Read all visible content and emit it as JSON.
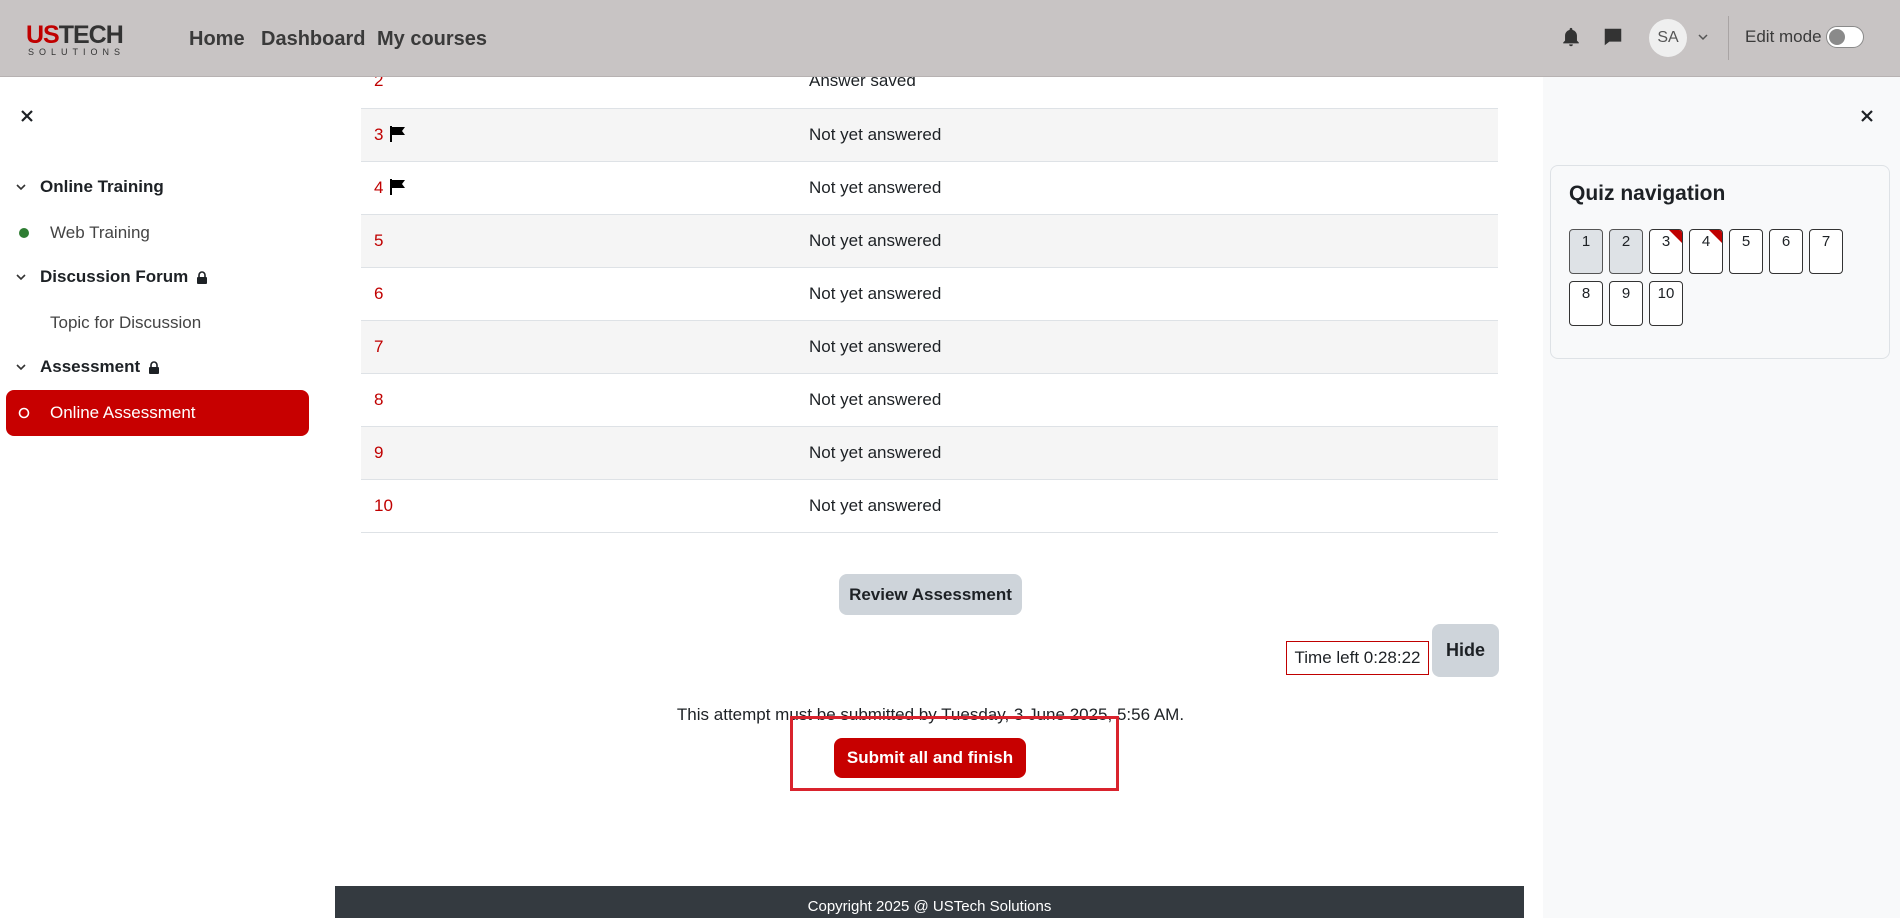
{
  "navbar": {
    "logo_main_accent": "US",
    "logo_main_rest": "TECH",
    "logo_sub": "SOLUTIONS",
    "links": [
      "Home",
      "Dashboard",
      "My courses"
    ],
    "avatar_initials": "SA",
    "edit_mode_label": "Edit mode",
    "edit_mode_on": false
  },
  "left_drawer": {
    "sections": [
      {
        "label": "Online Training",
        "locked": false
      },
      {
        "label": "Discussion Forum",
        "locked": true
      },
      {
        "label": "Assessment",
        "locked": true
      }
    ],
    "items": [
      {
        "label": "Web Training",
        "status": "complete"
      },
      {
        "label": "Topic for Discussion",
        "status": "none"
      },
      {
        "label": "Online Assessment",
        "status": "active"
      }
    ]
  },
  "summary": {
    "rows": [
      {
        "num": "2",
        "status": "Answer saved",
        "flagged": false
      },
      {
        "num": "3",
        "status": "Not yet answered",
        "flagged": true
      },
      {
        "num": "4",
        "status": "Not yet answered",
        "flagged": true
      },
      {
        "num": "5",
        "status": "Not yet answered",
        "flagged": false
      },
      {
        "num": "6",
        "status": "Not yet answered",
        "flagged": false
      },
      {
        "num": "7",
        "status": "Not yet answered",
        "flagged": false
      },
      {
        "num": "8",
        "status": "Not yet answered",
        "flagged": false
      },
      {
        "num": "9",
        "status": "Not yet answered",
        "flagged": false
      },
      {
        "num": "10",
        "status": "Not yet answered",
        "flagged": false
      }
    ],
    "review_label": "Review Assessment",
    "timer_label": "Time left 0:28:22",
    "hide_label": "Hide",
    "deadline_text": "This attempt must be submitted by Tuesday, 3 June 2025, 5:56 AM.",
    "submit_label": "Submit all and finish"
  },
  "footer": {
    "text": "Copyright 2025 @ USTech Solutions"
  },
  "quiz_nav": {
    "title": "Quiz navigation",
    "buttons": [
      {
        "num": "1",
        "answered": true,
        "flagged": false
      },
      {
        "num": "2",
        "answered": true,
        "flagged": false
      },
      {
        "num": "3",
        "answered": false,
        "flagged": true
      },
      {
        "num": "4",
        "answered": false,
        "flagged": true
      },
      {
        "num": "5",
        "answered": false,
        "flagged": false
      },
      {
        "num": "6",
        "answered": false,
        "flagged": false
      },
      {
        "num": "7",
        "answered": false,
        "flagged": false
      },
      {
        "num": "8",
        "answered": false,
        "flagged": false
      },
      {
        "num": "9",
        "answered": false,
        "flagged": false
      },
      {
        "num": "10",
        "answered": false,
        "flagged": false
      }
    ]
  },
  "colors": {
    "brand": "#c70000",
    "navbar_bg": "#c8c4c4",
    "footer_bg": "#343a40"
  },
  "icons": [
    "bell-icon",
    "chat-icon",
    "chevron-down-icon",
    "close-icon",
    "lock-icon",
    "flag-icon",
    "status-dot-icon"
  ]
}
